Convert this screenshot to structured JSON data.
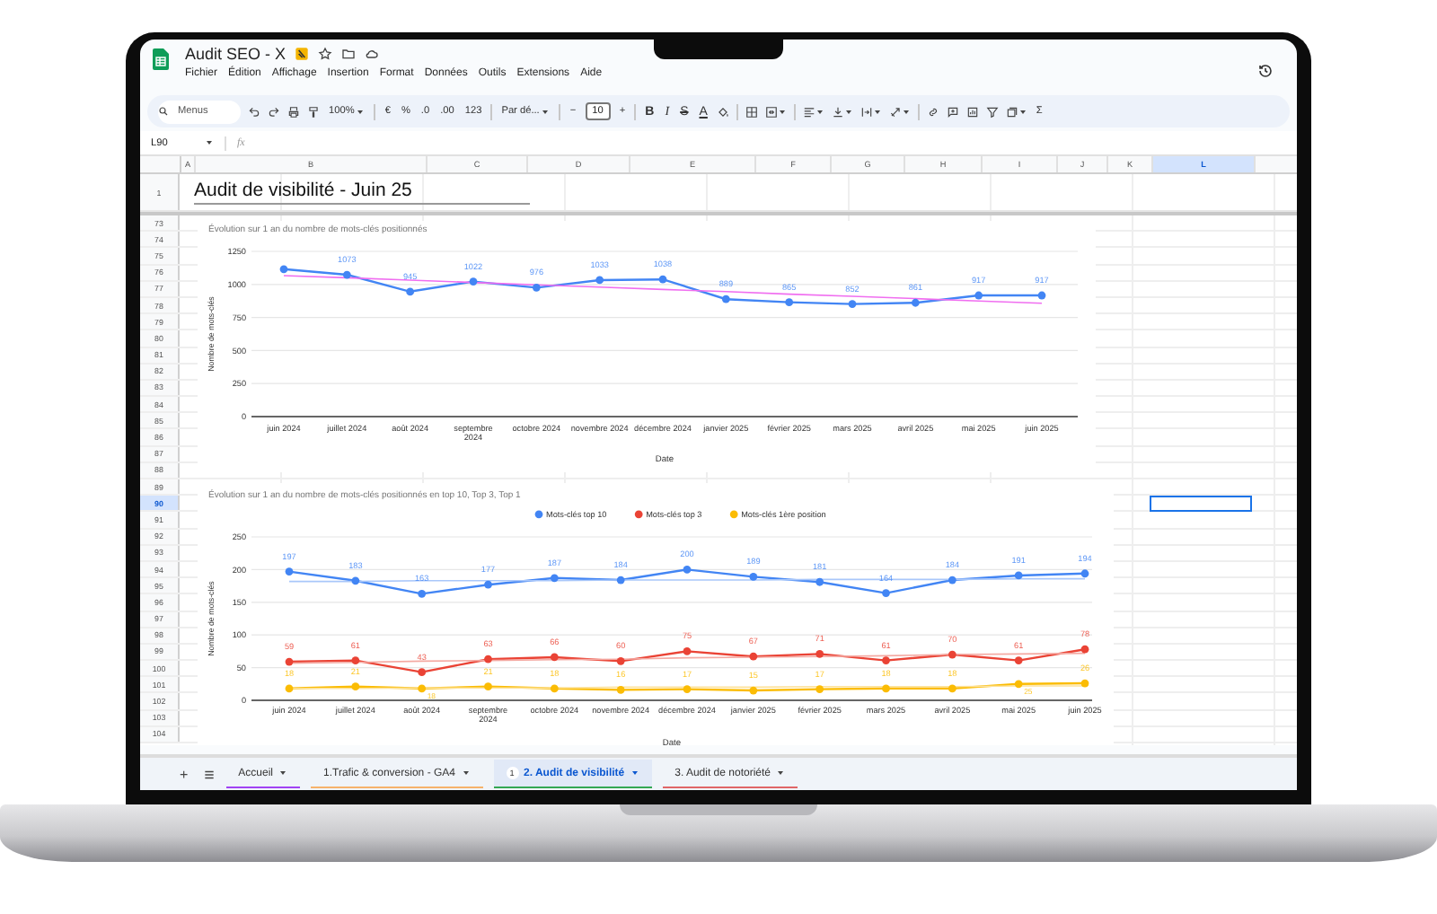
{
  "app": {
    "title": "Audit SEO - X",
    "menu": [
      "Fichier",
      "Édition",
      "Affichage",
      "Insertion",
      "Format",
      "Données",
      "Outils",
      "Extensions",
      "Aide"
    ]
  },
  "toolbar": {
    "search_placeholder": "Menus",
    "zoom": "100%",
    "currency": "€",
    "percent": "%",
    "decimal_decrease": ".0",
    "decimal_increase": ".00",
    "number_format": "123",
    "font": "Par dé...",
    "font_size_minus": "−",
    "font_size": "10",
    "font_size_plus": "+",
    "bold": "B",
    "italic": "I",
    "strikethrough": "S",
    "text_color": "A",
    "sum": "Σ"
  },
  "formula_bar": {
    "cell_ref": "L90",
    "fx": "fx"
  },
  "columns": [
    {
      "label": "A",
      "selected": false
    },
    {
      "label": "B",
      "selected": false
    },
    {
      "label": "C",
      "selected": false
    },
    {
      "label": "D",
      "selected": false
    },
    {
      "label": "E",
      "selected": false
    },
    {
      "label": "F",
      "selected": false
    },
    {
      "label": "G",
      "selected": false
    },
    {
      "label": "H",
      "selected": false
    },
    {
      "label": "I",
      "selected": false
    },
    {
      "label": "J",
      "selected": false
    },
    {
      "label": "K",
      "selected": false
    },
    {
      "label": "L",
      "selected": true
    }
  ],
  "title_row": {
    "number": "1",
    "text": "Audit de visibilité - Juin 25"
  },
  "rows": [
    {
      "number": "73",
      "selected": false
    },
    {
      "number": "74",
      "selected": false
    },
    {
      "number": "75",
      "selected": false
    },
    {
      "number": "76",
      "selected": false
    },
    {
      "number": "77",
      "selected": false
    },
    {
      "number": "78",
      "selected": false
    },
    {
      "number": "79",
      "selected": false
    },
    {
      "number": "80",
      "selected": false
    },
    {
      "number": "81",
      "selected": false
    },
    {
      "number": "82",
      "selected": false
    },
    {
      "number": "83",
      "selected": false
    },
    {
      "number": "84",
      "selected": false
    },
    {
      "number": "85",
      "selected": false
    },
    {
      "number": "86",
      "selected": false
    },
    {
      "number": "87",
      "selected": false
    },
    {
      "number": "88",
      "selected": false
    },
    {
      "number": "89",
      "selected": false
    },
    {
      "number": "90",
      "selected": true
    },
    {
      "number": "91",
      "selected": false
    },
    {
      "number": "92",
      "selected": false
    },
    {
      "number": "93",
      "selected": false
    },
    {
      "number": "94",
      "selected": false
    },
    {
      "number": "95",
      "selected": false
    },
    {
      "number": "96",
      "selected": false
    },
    {
      "number": "97",
      "selected": false
    },
    {
      "number": "98",
      "selected": false
    },
    {
      "number": "99",
      "selected": false
    },
    {
      "number": "100",
      "selected": false
    },
    {
      "number": "101",
      "selected": false
    },
    {
      "number": "102",
      "selected": false
    },
    {
      "number": "103",
      "selected": false
    },
    {
      "number": "104",
      "selected": false
    }
  ],
  "charts": [
    {
      "chart_data": {
        "type": "line",
        "title": "Évolution sur 1 an du nombre de mots-clés positionnés",
        "xlabel": "Date",
        "ylabel": "Nombre de mots-clés",
        "categories": [
          "juin 2024",
          "juillet 2024",
          "août 2024",
          "septembre 2024",
          "octobre 2024",
          "novembre 2024",
          "décembre 2024",
          "janvier 2025",
          "février 2025",
          "mars 2025",
          "avril 2025",
          "mai 2025",
          "juin 2025"
        ],
        "series": [
          {
            "marker": "o",
            "values": [
              1115,
              1073,
              945,
              1022,
              976,
              1033,
              1038,
              889,
              865,
              852,
              861,
              917,
              917
            ]
          },
          {
            "color": "#f06ef0",
            "values": [
              1067,
              1050,
              1032,
              1015,
              997,
              980,
              962,
              945,
              927,
              910,
              892,
              875,
              857
            ]
          }
        ],
        "value_labels": [
          null,
          "1073",
          "945",
          "1022",
          "976",
          "1033",
          "1038",
          "889",
          "865",
          "852",
          "861",
          "917",
          "917"
        ],
        "ylim": [
          0,
          1250
        ],
        "yticks": [
          0,
          250,
          500,
          750,
          1000,
          1250
        ],
        "grid": true
      }
    },
    {
      "chart_data": {
        "type": "line",
        "title": "Évolution sur 1 an du nombre de mots-clés positionnés en top 10, Top 3, Top 1",
        "xlabel": "Date",
        "ylabel": "Nombre de mots-clés",
        "categories": [
          "juin 2024",
          "juillet 2024",
          "août 2024",
          "septembre 2024",
          "octobre 2024",
          "novembre 2024",
          "décembre 2024",
          "janvier 2025",
          "février 2025",
          "mars 2025",
          "avril 2025",
          "mai 2025",
          "juin 2025"
        ],
        "series": [
          {
            "name": "Mots-clés top 10",
            "color": "#4285f4",
            "marker": "o",
            "values": [
              197,
              183,
              163,
              177,
              187,
              184,
              200,
              189,
              181,
              164,
              184,
              191,
              194
            ]
          },
          {
            "name": "Mots-clés top 3",
            "color": "#ea4335",
            "marker": "o",
            "values": [
              59,
              61,
              43,
              63,
              66,
              60,
              75,
              67,
              71,
              61,
              70,
              61,
              78
            ]
          },
          {
            "name": "Mots-clés 1ère position",
            "color": "#fbbc04",
            "marker": "o",
            "values": [
              18,
              21,
              18,
              21,
              18,
              16,
              17,
              15,
              17,
              18,
              18,
              25,
              26
            ]
          },
          {
            "color": "#a9c7fa",
            "values": [
              182,
              182,
              183,
              183,
              183,
              184,
              184,
              184,
              185,
              185,
              185,
              186,
              186
            ]
          },
          {
            "color": "#f4a9a2",
            "values": [
              57,
              58,
              60,
              61,
              62,
              63,
              65,
              66,
              67,
              68,
              70,
              71,
              72
            ]
          },
          {
            "color": "#fde29b",
            "values": [
              18,
              18,
              19,
              19,
              19,
              20,
              20,
              20,
              21,
              21,
              21,
              22,
              22
            ]
          }
        ],
        "value_labels": [
          [
            "197",
            "183",
            "163",
            "177",
            "187",
            "184",
            "200",
            "189",
            "181",
            "164",
            "184",
            "191",
            "194"
          ],
          [
            "59",
            "61",
            "43",
            "63",
            "66",
            "60",
            "75",
            "67",
            "71",
            "61",
            "70",
            "61",
            "78"
          ],
          [
            "18",
            "21",
            "18",
            "21",
            "18",
            "16",
            "17",
            "15",
            "17",
            "18",
            "18",
            "25",
            "26"
          ],
          null,
          null,
          null
        ],
        "ylim": [
          0,
          250
        ],
        "yticks": [
          0,
          50,
          100,
          150,
          200,
          250
        ],
        "grid": true,
        "legend": "top"
      }
    }
  ],
  "sheet_tabs": {
    "add": "+",
    "tabs": [
      {
        "label": "Accueil",
        "color": "#a142f4",
        "selected": false
      },
      {
        "label": "1.Trafic & conversion - GA4",
        "color": "#f6b26b",
        "selected": false
      },
      {
        "label": "2. Audit de visibilité",
        "color": "#34a853",
        "selected": true,
        "badge": "1"
      },
      {
        "label": "3. Audit de notoriété",
        "color": "#e06666",
        "selected": false
      }
    ]
  }
}
